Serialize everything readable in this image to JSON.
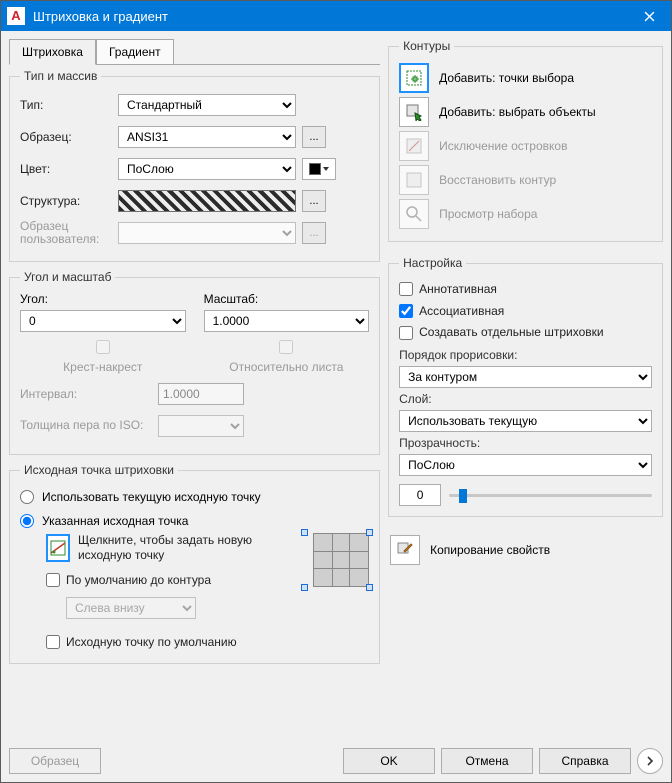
{
  "window": {
    "title": "Штриховка и градиент"
  },
  "tabs": {
    "hatch": "Штриховка",
    "gradient": "Градиент"
  },
  "type_array": {
    "legend": "Тип и массив",
    "type_label": "Тип:",
    "type_value": "Стандартный",
    "pattern_label": "Образец:",
    "pattern_value": "ANSI31",
    "color_label": "Цвет:",
    "color_value": "ПоСлою",
    "structure_label": "Структура:",
    "user_pattern_label": "Образец пользователя:"
  },
  "angle_scale": {
    "legend": "Угол и масштаб",
    "angle_label": "Угол:",
    "angle_value": "0",
    "scale_label": "Масштаб:",
    "scale_value": "1.0000",
    "crosshatch": "Крест-накрест",
    "relative_paper": "Относительно листа",
    "interval_label": "Интервал:",
    "interval_value": "1.0000",
    "iso_pen_label": "Толщина пера по ISO:"
  },
  "origin": {
    "legend": "Исходная точка штриховки",
    "use_current": "Использовать текущую исходную точку",
    "specified": "Указанная исходная точка",
    "click_to_set": "Щелкните, чтобы задать новую исходную точку",
    "default_to_boundary": "По умолчанию до контура",
    "position_value": "Слева внизу",
    "store_default": "Исходную точку по умолчанию"
  },
  "boundaries": {
    "legend": "Контуры",
    "add_pick": "Добавить: точки выбора",
    "add_select": "Добавить: выбрать объекты",
    "remove_islands": "Исключение островков",
    "recreate": "Восстановить контур",
    "view_selection": "Просмотр набора"
  },
  "settings": {
    "legend": "Настройка",
    "annotative": "Аннотативная",
    "associative": "Ассоциативная",
    "separate": "Создавать отдельные штриховки",
    "draw_order_label": "Порядок прорисовки:",
    "draw_order_value": "За контуром",
    "layer_label": "Слой:",
    "layer_value": "Использовать текущую",
    "transparency_label": "Прозрачность:",
    "transparency_value": "ПоСлою",
    "transparency_num": "0"
  },
  "inherit": {
    "label": "Копирование свойств"
  },
  "buttons": {
    "preview": "Образец",
    "ok": "OK",
    "cancel": "Отмена",
    "help": "Справка"
  }
}
